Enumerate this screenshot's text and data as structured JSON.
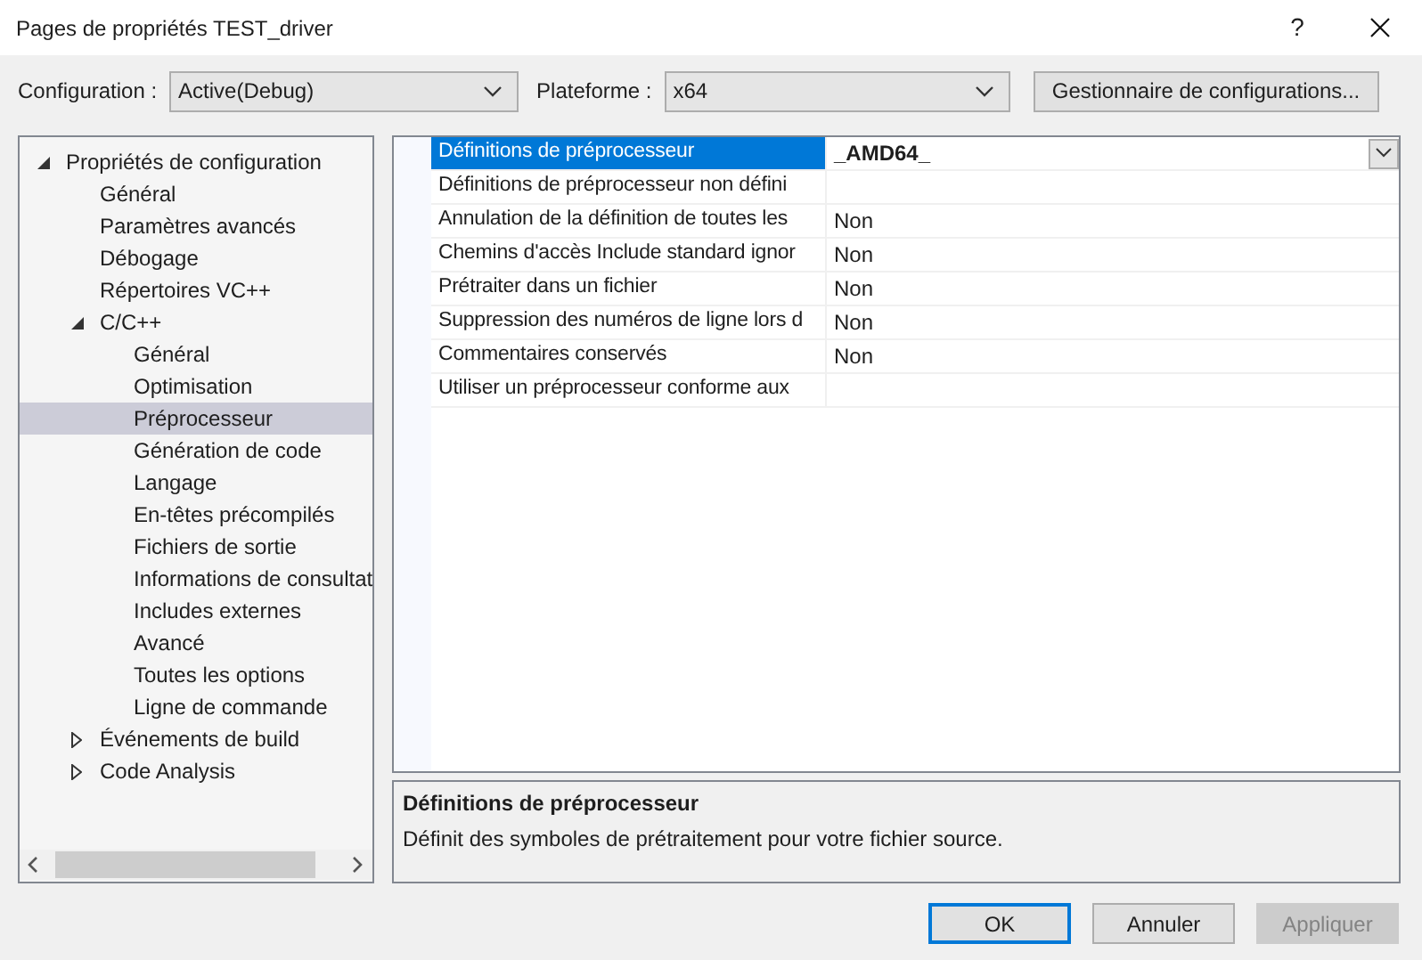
{
  "window": {
    "title": "Pages de propriétés TEST_driver",
    "help": "?"
  },
  "toolbar": {
    "configuration_label": "Configuration :",
    "configuration_value": "Active(Debug)",
    "platform_label": "Plateforme :",
    "platform_value": "x64",
    "manager_button": "Gestionnaire de configurations..."
  },
  "tree": [
    {
      "label": "Propriétés de configuration",
      "expanded": true,
      "selected": false,
      "children": [
        {
          "label": "Général",
          "selected": false
        },
        {
          "label": "Paramètres avancés",
          "selected": false
        },
        {
          "label": "Débogage",
          "selected": false
        },
        {
          "label": "Répertoires VC++",
          "selected": false
        },
        {
          "label": "C/C++",
          "expanded": true,
          "selected": false,
          "children": [
            {
              "label": "Général",
              "selected": false
            },
            {
              "label": "Optimisation",
              "selected": false
            },
            {
              "label": "Préprocesseur",
              "selected": true
            },
            {
              "label": "Génération de code",
              "selected": false
            },
            {
              "label": "Langage",
              "selected": false
            },
            {
              "label": "En-têtes précompilés",
              "selected": false
            },
            {
              "label": "Fichiers de sortie",
              "selected": false
            },
            {
              "label": "Informations de consultat",
              "selected": false
            },
            {
              "label": "Includes externes",
              "selected": false
            },
            {
              "label": "Avancé",
              "selected": false
            },
            {
              "label": "Toutes les options",
              "selected": false
            },
            {
              "label": "Ligne de commande",
              "selected": false
            }
          ]
        },
        {
          "label": "Événements de build",
          "expanded": false,
          "selected": false
        },
        {
          "label": "Code Analysis",
          "expanded": false,
          "selected": false
        }
      ]
    }
  ],
  "properties": [
    {
      "name": "Définitions de préprocesseur",
      "value": "_AMD64_",
      "selected": true
    },
    {
      "name": "Définitions de préprocesseur non défini",
      "selected": false
    },
    {
      "name": "Annulation de la définition de toutes les",
      "value": "Non",
      "selected": false
    },
    {
      "name": "Chemins d'accès Include standard ignor",
      "value": "Non",
      "selected": false
    },
    {
      "name": "Prétraiter dans un fichier",
      "value": "Non",
      "selected": false
    },
    {
      "name": "Suppression des numéros de ligne lors d",
      "value": "Non",
      "selected": false
    },
    {
      "name": "Commentaires conservés",
      "value": "Non",
      "selected": false
    },
    {
      "name": "Utiliser un préprocesseur conforme aux",
      "selected": false
    }
  ],
  "description": {
    "title": "Définitions de préprocesseur",
    "text": "Définit des symboles de prétraitement pour votre fichier source."
  },
  "buttons": [
    {
      "label": "OK",
      "default": true,
      "disabled": false
    },
    {
      "label": "Annuler",
      "default": false,
      "disabled": false
    },
    {
      "label": "Appliquer",
      "default": false,
      "disabled": true
    }
  ]
}
